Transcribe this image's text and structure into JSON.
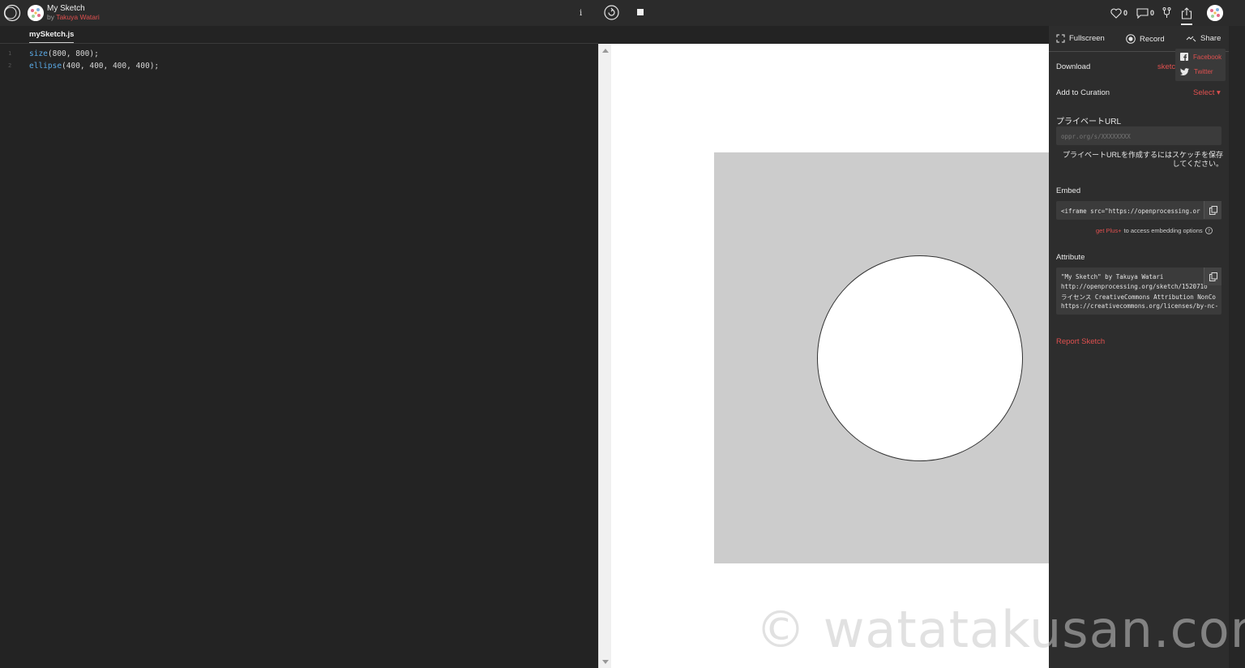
{
  "header": {
    "sketch_title": "My Sketch",
    "by_prefix": "by",
    "author": "Takuya Watari",
    "info_label": "i",
    "likes_count": "0",
    "comments_count": "0"
  },
  "editor": {
    "tab_name": "mySketch.js",
    "lines": [
      {
        "num": "1",
        "fn": "size",
        "args": "(800, 800);"
      },
      {
        "num": "2",
        "fn": "ellipse",
        "args": "(400, 400, 400, 400);"
      }
    ]
  },
  "panel": {
    "fullscreen_label": "Fullscreen",
    "record_label": "Record",
    "share_label": "Share",
    "download_label": "Download",
    "download_value": "sketc",
    "curation_label": "Add to Curation",
    "curation_select": "Select ▾",
    "private_url_label": "プライベートURL",
    "private_url_placeholder": "oppr.org/s/XXXXXXXX",
    "private_url_note": "プライベートURLを作成するにはスケッチを保存してください。",
    "embed_label": "Embed",
    "embed_code": "<iframe src=\"https://openprocessing.org",
    "get_plus": "get Plus+",
    "embed_note": "to access embedding options",
    "attribute_label": "Attribute",
    "attribute_lines": [
      "\"My Sketch\" by Takuya Watari",
      "http://openprocessing.org/sketch/152071o",
      "ライセンス CreativeCommons Attribution NonCo",
      "https://creativecommons.org/licenses/by-nc-"
    ],
    "report_label": "Report Sketch"
  },
  "share_menu": {
    "facebook": "Facebook",
    "twitter": "Twitter"
  },
  "watermark": "© watatakusan.com",
  "colors": {
    "accent_red": "#e0504f",
    "code_function": "#5aa9e6",
    "sketch_background": "#cccccc"
  }
}
